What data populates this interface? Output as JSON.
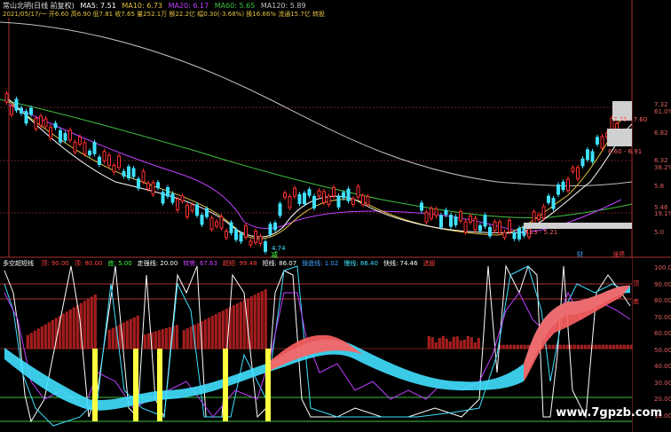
{
  "top_panel": {
    "title": "常山北明(日线 前复权)",
    "ma5": "MA5: 7.51",
    "ma10": "MA10: 6.73",
    "ma20": "MA20: 6.17",
    "ma60": "MA60: 5.65",
    "ma120": "MA120: 5.89",
    "info": "2021/05/17/一 开6.60 高6.90 低7.81 收7.65 量252.1万 额22.2亿 幅0.30(-3.68%) 换16.66% 流通15.7亿 转股",
    "price_high_label": "7.75 - 7.60",
    "price_mid_label": "6.60 - 6.91",
    "price_low_label": "4.74",
    "price_low2_label": "5.13 - 5.21",
    "axis_labels": [
      "7.32",
      "61.0%",
      "6.82",
      "6.32",
      "38.2%",
      "5.8",
      "5.46",
      "19.1%",
      "5.0"
    ],
    "marker_left": "减",
    "marker_right1": "财",
    "marker_right2": "涨停"
  },
  "bottom_panel": {
    "title": "多空超短线",
    "items": [
      {
        "text": "顶: 90.00",
        "color": "#ff4040"
      },
      {
        "text": "顶: 80.00",
        "color": "#ff4040"
      },
      {
        "text": "底: 5.00",
        "color": "#40ff40"
      },
      {
        "text": "走强线: 20.00",
        "color": "#ffffff"
      },
      {
        "text": "转势: 67.63",
        "color": "#d040ff"
      },
      {
        "text": "超短: 99.48",
        "color": "#ff4040"
      },
      {
        "text": "短线: 86.07",
        "color": "#ffffff"
      },
      {
        "text": "操盘线: 1.02",
        "color": "#40a0ff"
      },
      {
        "text": "慢线: 86.40",
        "color": "#40e0ff"
      },
      {
        "text": "快线: 74.46",
        "color": "#ffffff"
      },
      {
        "text": "选股",
        "color": "#ff4040"
      }
    ],
    "axis_labels": [
      "100.0",
      "90.00",
      "80.00",
      "70.00",
      "60.00",
      "50.00",
      "40.00",
      "30.00",
      "20.00",
      "10.00"
    ],
    "label_top": "顶",
    "label_bottom": "底"
  },
  "watermark": "www.7gpzb.com",
  "colors": {
    "up": "#ff3030",
    "down": "#40e0ff",
    "ma5": "#ffffff",
    "ma10": "#e0c040",
    "ma20": "#c040ff",
    "ma60": "#40c040",
    "ma120": "#c0c0c0"
  }
}
